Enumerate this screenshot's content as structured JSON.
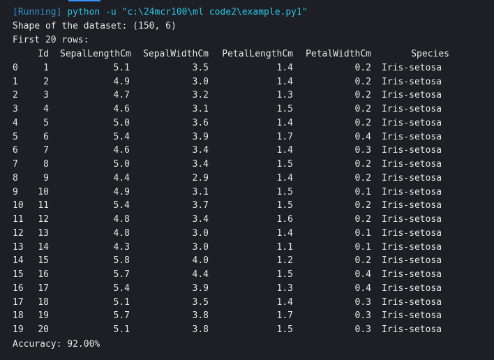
{
  "output": {
    "running_tag": "[Running]",
    "command": "python -u \"c:\\24mcr100\\ml code2\\example.py1\"",
    "shape_line": "Shape of the dataset: (150, 6)",
    "first_rows_line": "First 20 rows:",
    "accuracy_line": "Accuracy: 92.00%"
  },
  "table": {
    "columns": [
      "",
      "Id",
      "SepalLengthCm",
      "SepalWidthCm",
      "PetalLengthCm",
      "PetalWidthCm",
      "Species"
    ],
    "rows": [
      [
        "0",
        "1",
        "5.1",
        "3.5",
        "1.4",
        "0.2",
        "Iris-setosa"
      ],
      [
        "1",
        "2",
        "4.9",
        "3.0",
        "1.4",
        "0.2",
        "Iris-setosa"
      ],
      [
        "2",
        "3",
        "4.7",
        "3.2",
        "1.3",
        "0.2",
        "Iris-setosa"
      ],
      [
        "3",
        "4",
        "4.6",
        "3.1",
        "1.5",
        "0.2",
        "Iris-setosa"
      ],
      [
        "4",
        "5",
        "5.0",
        "3.6",
        "1.4",
        "0.2",
        "Iris-setosa"
      ],
      [
        "5",
        "6",
        "5.4",
        "3.9",
        "1.7",
        "0.4",
        "Iris-setosa"
      ],
      [
        "6",
        "7",
        "4.6",
        "3.4",
        "1.4",
        "0.3",
        "Iris-setosa"
      ],
      [
        "7",
        "8",
        "5.0",
        "3.4",
        "1.5",
        "0.2",
        "Iris-setosa"
      ],
      [
        "8",
        "9",
        "4.4",
        "2.9",
        "1.4",
        "0.2",
        "Iris-setosa"
      ],
      [
        "9",
        "10",
        "4.9",
        "3.1",
        "1.5",
        "0.1",
        "Iris-setosa"
      ],
      [
        "10",
        "11",
        "5.4",
        "3.7",
        "1.5",
        "0.2",
        "Iris-setosa"
      ],
      [
        "11",
        "12",
        "4.8",
        "3.4",
        "1.6",
        "0.2",
        "Iris-setosa"
      ],
      [
        "12",
        "13",
        "4.8",
        "3.0",
        "1.4",
        "0.1",
        "Iris-setosa"
      ],
      [
        "13",
        "14",
        "4.3",
        "3.0",
        "1.1",
        "0.1",
        "Iris-setosa"
      ],
      [
        "14",
        "15",
        "5.8",
        "4.0",
        "1.2",
        "0.2",
        "Iris-setosa"
      ],
      [
        "15",
        "16",
        "5.7",
        "4.4",
        "1.5",
        "0.4",
        "Iris-setosa"
      ],
      [
        "16",
        "17",
        "5.4",
        "3.9",
        "1.3",
        "0.4",
        "Iris-setosa"
      ],
      [
        "17",
        "18",
        "5.1",
        "3.5",
        "1.4",
        "0.3",
        "Iris-setosa"
      ],
      [
        "18",
        "19",
        "5.7",
        "3.8",
        "1.7",
        "0.3",
        "Iris-setosa"
      ],
      [
        "19",
        "20",
        "5.1",
        "3.8",
        "1.5",
        "0.3",
        "Iris-setosa"
      ]
    ]
  },
  "colors": {
    "background": "#1e1f24",
    "text": "#e6e6e6",
    "running_tag": "#2f8fc9",
    "command": "#27c3e3",
    "accent": "#3794ff"
  }
}
